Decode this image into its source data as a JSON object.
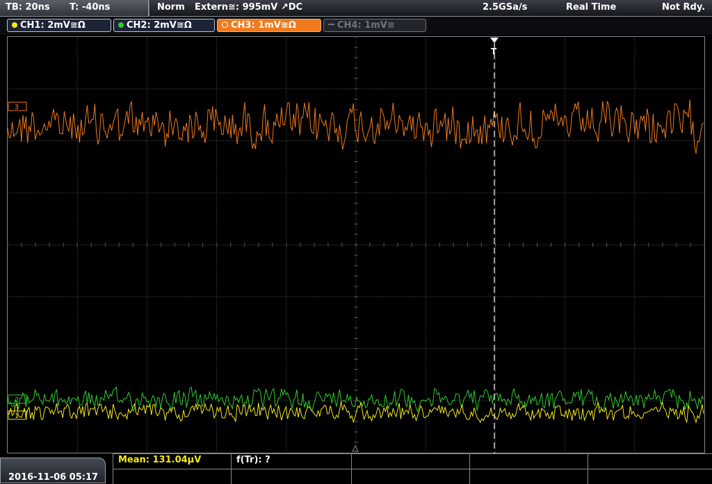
{
  "topbar": {
    "timebase": "TB: 20ns",
    "trigger_offset": "T: -40ns",
    "trigger_mode": "Norm",
    "trigger_source": "Extern≅: 995mV ↗DC",
    "sample_rate": "2.5GSa/s",
    "acquisition_mode": "Real Time",
    "status": "Not Rdy."
  },
  "channels": [
    {
      "label": "CH1: 2mV≅Ω",
      "color": "#f5ea1a",
      "active": false,
      "enabled": true
    },
    {
      "label": "CH2: 2mV≅Ω",
      "color": "#2ecb2e",
      "active": false,
      "enabled": true
    },
    {
      "label": "CH3: 1mV≅Ω",
      "color": "#f07a1e",
      "active": true,
      "enabled": true
    },
    {
      "label": "CH4: 1mV≅",
      "color": "#70747c",
      "active": false,
      "enabled": false
    }
  ],
  "waveform_markers": {
    "ch3": "3",
    "ch2": "2",
    "ch1": "1",
    "trigger": "T"
  },
  "measurements": {
    "mean": "Mean: 131.04µV",
    "frequency": "f(Tr): ?"
  },
  "datetime": "2016-11-06 05:17",
  "colors": {
    "ch1": "#f5ea1a",
    "ch2": "#2ecb2e",
    "ch3": "#f07a1e",
    "grid": "#3c3c3c",
    "trigger_line": "#ffffff"
  }
}
